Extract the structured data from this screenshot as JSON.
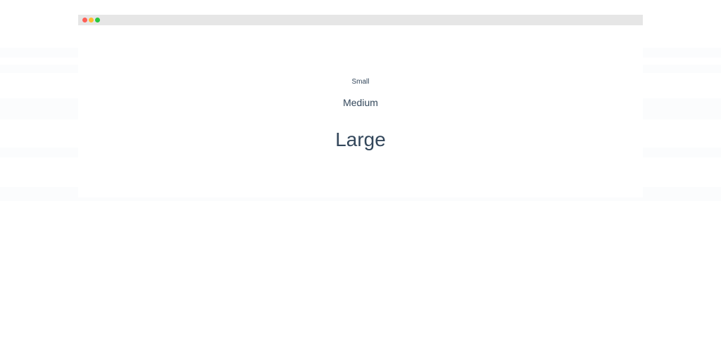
{
  "window": {
    "controls": {
      "close_color": "#ff5f57",
      "minimize_color": "#febc2e",
      "maximize_color": "#28c840"
    }
  },
  "samples": {
    "small": "Small",
    "medium": "Medium",
    "large": "Large"
  },
  "colors": {
    "text": "#33475b",
    "titlebar": "#e6e6e6",
    "background": "#ffffff"
  }
}
